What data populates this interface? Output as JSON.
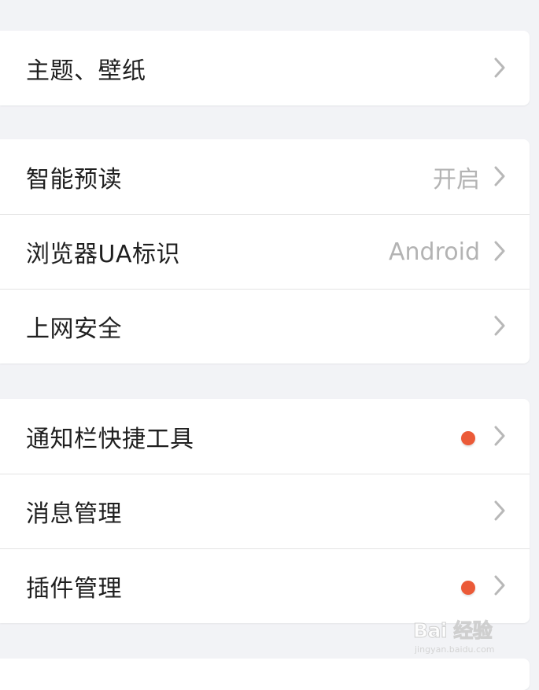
{
  "groups": [
    {
      "items": [
        {
          "label": "主题、壁纸",
          "value": "",
          "badge": false
        }
      ]
    },
    {
      "items": [
        {
          "label": "智能预读",
          "value": "开启",
          "badge": false
        },
        {
          "label": "浏览器UA标识",
          "value": "Android",
          "badge": false
        },
        {
          "label": "上网安全",
          "value": "",
          "badge": false
        }
      ]
    },
    {
      "items": [
        {
          "label": "通知栏快捷工具",
          "value": "",
          "badge": true
        },
        {
          "label": "消息管理",
          "value": "",
          "badge": false
        },
        {
          "label": "插件管理",
          "value": "",
          "badge": true
        }
      ]
    }
  ],
  "colors": {
    "background": "#f2f3f6",
    "card": "#ffffff",
    "badge": "#eb5a38",
    "value_text": "#b3b3b3",
    "chevron": "#b8b8b8"
  },
  "icons": {
    "chevron": "chevron-right-icon",
    "badge": "red-dot-badge"
  },
  "watermark": {
    "logo_text": "Bai 经验",
    "url": "jingyan.baidu.com"
  }
}
